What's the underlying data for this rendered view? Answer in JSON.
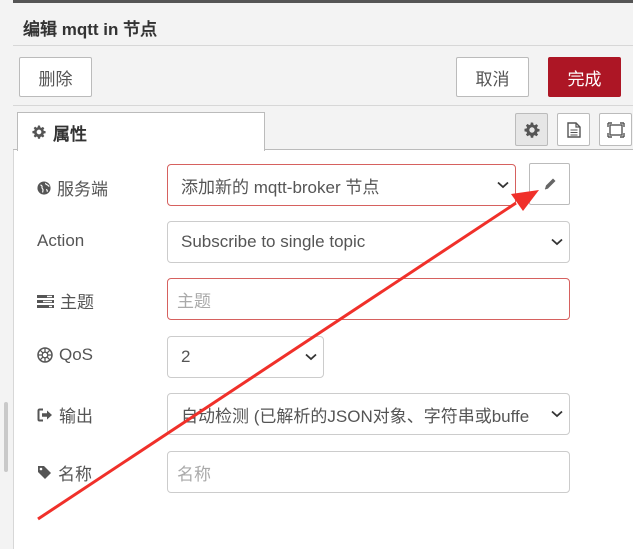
{
  "tray": {
    "title": "编辑 mqtt in 节点",
    "delete_label": "删除",
    "cancel_label": "取消",
    "done_label": "完成",
    "done_color": "#ad1625"
  },
  "tabs": {
    "properties_label": "属性",
    "active_icon": "gear-icon",
    "icons": [
      "gear-icon",
      "description-icon",
      "appearance-icon"
    ]
  },
  "form": {
    "server": {
      "label": "服务端",
      "icon": "globe-icon",
      "value": "添加新的 mqtt-broker 节点"
    },
    "action": {
      "label": "Action",
      "value": "Subscribe to single topic"
    },
    "topic": {
      "label": "主题",
      "icon": "tasks-icon",
      "placeholder": "主题",
      "value": ""
    },
    "qos": {
      "label": "QoS",
      "icon": "empire-icon",
      "value": "2"
    },
    "output": {
      "label": "输出",
      "icon": "sign-out-icon",
      "value": "自动检测 (已解析的JSON对象、字符串或buffe"
    },
    "name": {
      "label": "名称",
      "icon": "tag-icon",
      "placeholder": "名称",
      "value": ""
    }
  },
  "annotation": {
    "arrow_color": "#f0302a"
  }
}
